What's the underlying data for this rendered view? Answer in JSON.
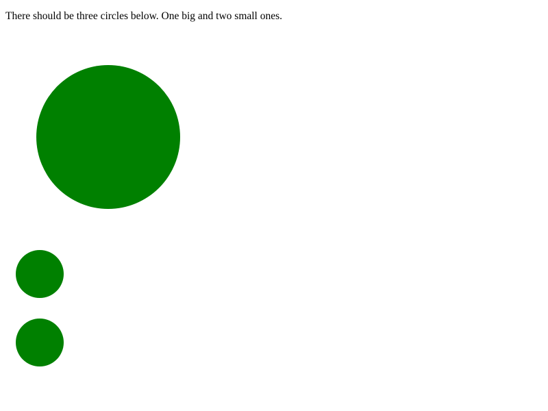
{
  "caption": "There should be three circles below. One big and two small ones.",
  "circles": [
    {
      "label": "big-circle",
      "color": "#008000"
    },
    {
      "label": "small-circle-top",
      "color": "#008000"
    },
    {
      "label": "small-circle-bottom",
      "color": "#008000"
    }
  ]
}
